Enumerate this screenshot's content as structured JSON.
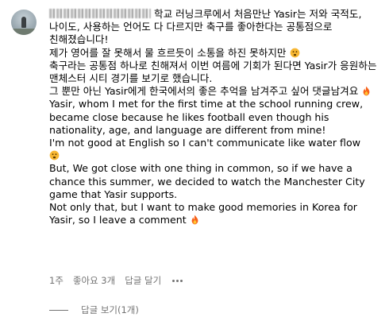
{
  "comment": {
    "body": "학교 러닝크루에서 처음만난 Yasir는 저와 국적도, 나이도, 사용하는 언어도 다 다르지만 축구를 좋아한다는 공통점으로 친해졌습니다!\n제가 영어를 잘 못해서 물 흐르듯이 소통을 하진 못하지만 ",
    "body_2": "\n축구라는 공통점 하나로 친해져서 이번 여름에 기회가 된다면 Yasir가 응원하는 맨체스터 시티 경기를 보기로 했습니다.\n그 뿐만 아닌 Yasir에게 한국에서의 좋은 추억을 남겨주고 싶어 댓글남겨요 ",
    "body_3": "\nYasir, whom I met for the first time at the school running crew, became close because he likes football even though his nationality, age, and language are different from mine!\nI'm not good at English so I can't communicate like water flow\n",
    "body_4": "\nBut, We got close with one thing in common, so if we have a chance this summer, we decided to watch the Manchester City game that Yasir supports.\nNot only that, but I want to make good memories in Korea for Yasir, so I leave a comment ",
    "emoji_1": "sad-face-emoji",
    "emoji_2": "fire-emoji",
    "emoji_3": "sad-face-emoji",
    "emoji_4": "fire-emoji"
  },
  "meta": {
    "time": "1주",
    "likes": "좋아요 3개",
    "reply": "답글 달기"
  },
  "replies": {
    "label": "답글 보기(1개)"
  },
  "colors": {
    "text": "#000000",
    "secondary": "#737373"
  }
}
